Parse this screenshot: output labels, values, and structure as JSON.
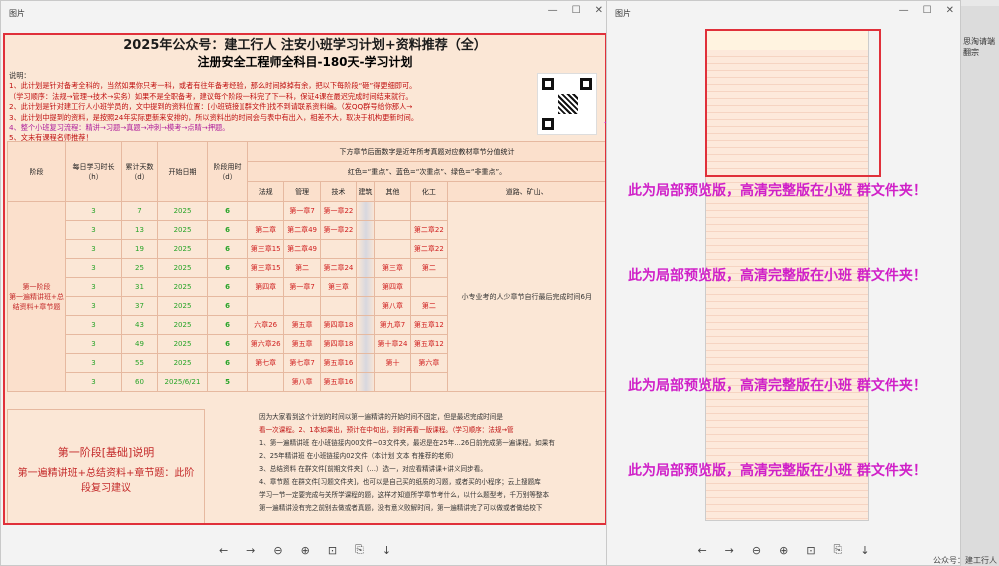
{
  "left_window": {
    "title": "图片",
    "doc_title": "2025年公众号：建工行人 注安小班学习计划+资料推荐（全）",
    "doc_subtitle": "注册安全工程师全科目-180天-学习计划",
    "notes": [
      "说明：",
      "1、此计划是针对备考全科的，当然如果你只考一科，或者有往年备考经验，那么时间掉掉有余，把以下每阶段“砸”得更细即可。",
      "（学习顺序：法规→管理→技术→实务）如果不是全职备考，建议每个阶段一科完了下一科，保证4课在最迟完成时间结束就行。",
      "2、此计划是针对建工行人小班学员的，文中提到的资料位置：[小班链接][群文件]找不到请联系资料编。（发QQ群号给你那人→",
      "3、此计划中提到的资料，是按照24年实际更新来安排的，所以资料出的时间会与表中有出入，相差不大，取决于机构更新时间。",
      "4、整个小班复习流程：精讲→习题→真题→冲刺→模考→点睛→押题。",
      "5、文末有课程名师推荐！"
    ],
    "table": {
      "headers": [
        "阶段",
        "每日学习时长（h）",
        "累计天数（d）",
        "开始日期",
        "阶段用时（d）"
      ],
      "note_header": "下方章节后面数字是近年所考真题对应教材章节分值统计",
      "legend": "红色=“重点”、蓝色=“次重点”、绿色=“非重点”。",
      "subjects": [
        "法规",
        "管理",
        "技术",
        "建筑",
        "其他",
        "化工",
        "道路、矿山、"
      ],
      "phase_label": "第一阶段\n第一遍精讲班+总结资料+章节题",
      "rows": [
        {
          "hours": "3",
          "days": "7",
          "date": "2025",
          "used": "6",
          "c1": "",
          "c2": "第一章7",
          "c3": "第一章22",
          "c5": "",
          "c6": ""
        },
        {
          "hours": "3",
          "days": "13",
          "date": "2025",
          "used": "6",
          "c1": "第二章",
          "c2": "第二章49",
          "c3": "第一章22",
          "c5": "",
          "c6": "第二章22"
        },
        {
          "hours": "3",
          "days": "19",
          "date": "2025",
          "used": "6",
          "c1": "第三章15",
          "c2": "第二章49",
          "c3": "",
          "c5": "",
          "c6": "第二章22"
        },
        {
          "hours": "3",
          "days": "25",
          "date": "2025",
          "used": "6",
          "c1": "第三章15",
          "c2": "第二",
          "c3": "第二章24",
          "c5": "第三章",
          "c6": "第二"
        },
        {
          "hours": "3",
          "days": "31",
          "date": "2025",
          "used": "6",
          "c1": "第四章",
          "c2": "第一章7",
          "c3": "第三章",
          "c5": "第四章",
          "c6": ""
        },
        {
          "hours": "3",
          "days": "37",
          "date": "2025",
          "used": "6",
          "c1": "",
          "c2": "",
          "c3": "",
          "c5": "第八章",
          "c6": "第二"
        },
        {
          "hours": "3",
          "days": "43",
          "date": "2025",
          "used": "6",
          "c1": "六章26",
          "c2": "第五章",
          "c3": "第四章18",
          "c5": "第九章7",
          "c6": "第五章12"
        },
        {
          "hours": "3",
          "days": "49",
          "date": "2025",
          "used": "6",
          "c1": "第六章26",
          "c2": "第五章",
          "c3": "第四章18",
          "c5": "第十章24",
          "c6": "第五章12"
        },
        {
          "hours": "3",
          "days": "55",
          "date": "2025",
          "used": "6",
          "c1": "第七章",
          "c2": "第七章7",
          "c3": "第五章16",
          "c5": "第十",
          "c6": "第六章"
        },
        {
          "hours": "3",
          "days": "60",
          "date": "2025/6/21",
          "used": "5",
          "c1": "",
          "c2": "第八章",
          "c3": "第五章16",
          "c5": "",
          "c6": ""
        }
      ],
      "side_note": "小专业考的人少章节自行最后完成时间6月",
      "bottom_title": "第一阶段[基础]说明",
      "bottom_desc": "第一遍精讲班+总结资料+章节题：此阶段复习建议",
      "bottom_notes": [
        "因为大家看到这个计划的时间以第一遍精讲的开始时间不固定，但是最迟完成时间是",
        "看一次课程。2、1本如果出，预计在中旬出，到时再看一版课程。（学习顺序：法规→管",
        "1、第一遍精讲班 在小班链接内00文件~03文件夹，最迟是在25年…26日前完成第一遍课程。如果有",
        "2、25年精讲班 在小班链接内02文件（本计划 文本 有推荐的老师）",
        "3、总结资料 在群文件[前期文件夹]（…）选一，对应看精讲课+讲义同步看。",
        "4、章节题 在群文件[习题文件夹]，也可以是自己买的纸质的习题，或者买的小程序；云上搜题库",
        "学习一节一定要完成与关所学课程的题，这样才知道所学章节考什么，以什么题型考，千万别等整本",
        "第一遍精讲没有完之前别去做或者真题，没有意义败解时间，第一遍精讲完了可以做或者做给校下"
      ]
    }
  },
  "right_window": {
    "title": "图片",
    "promo_text": "此为局部预览版，高清完整版在小班 群文件夹！",
    "side_fragment": "思淘请端翻宗",
    "watermark": "公众号：建工行人"
  },
  "toolbar": [
    "←",
    "→",
    "⊖",
    "⊕",
    "⊡",
    "⎘",
    "↓"
  ]
}
